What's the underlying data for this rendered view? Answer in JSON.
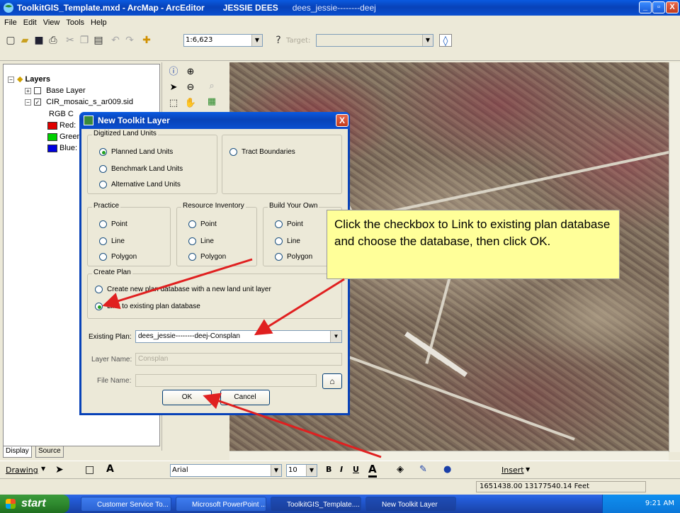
{
  "window": {
    "title": "ToolkitGIS_Template.mxd - ArcMap - ArcEditor",
    "user": "JESSIE DEES",
    "database_tag": "dees_jessie--------deej",
    "controls": {
      "minimize": "_",
      "maximize": "▫",
      "close": "X"
    }
  },
  "menu": [
    "File",
    "Edit",
    "View",
    "Tools",
    "Help"
  ],
  "toolbar": {
    "scale": "1:6,623",
    "target_label": "Target:",
    "target_value": ""
  },
  "toc": {
    "root": "Layers",
    "items": [
      {
        "label": "Base Layer",
        "checked": false
      },
      {
        "label": "CIR_mosaic_s_ar009.sid",
        "checked": true
      }
    ],
    "rgb_label": "RGB C",
    "bands": [
      {
        "label": "Red:",
        "color": "#e00000"
      },
      {
        "label": "Green:",
        "color": "#00d000"
      },
      {
        "label": "Blue:",
        "color": "#0000e0"
      }
    ],
    "tabs": [
      "Display",
      "Source"
    ]
  },
  "dialog": {
    "title": "New Toolkit Layer",
    "close_label": "X",
    "digitized": {
      "label": "Digitized Land Units",
      "options": [
        "Planned Land Units",
        "Benchmark Land Units",
        "Alternative Land Units"
      ],
      "tract": "Tract Boundaries"
    },
    "practice": {
      "label": "Practice",
      "options": [
        "Point",
        "Line",
        "Polygon"
      ]
    },
    "resource": {
      "label": "Resource Inventory",
      "options": [
        "Point",
        "Line",
        "Polygon"
      ]
    },
    "build": {
      "label": "Build Your Own",
      "options": [
        "Point",
        "Line",
        "Polygon"
      ]
    },
    "create_plan": {
      "label": "Create Plan",
      "new_db": "Create new plan database with a new land unit layer",
      "link_db": "Link to existing plan database"
    },
    "existing_plan": {
      "label": "Existing Plan:",
      "value": "dees_jessie--------deej-Consplan"
    },
    "layer_name": {
      "label": "Layer Name:",
      "value": "Consplan"
    },
    "file_name": {
      "label": "File Name:",
      "value": ""
    },
    "ok": "OK",
    "cancel": "Cancel"
  },
  "callout": "Click the checkbox to Link to existing plan database and choose the database, then click OK.",
  "drawbar": {
    "drawing": "Drawing",
    "font": "Arial",
    "size": "10",
    "insert": "Insert"
  },
  "status": {
    "coords": "1651438.00 13177540.14 Feet"
  },
  "taskbar": {
    "start": "start",
    "tasks": [
      "Customer Service To...",
      "Microsoft PowerPoint ...",
      "ToolkitGIS_Template....",
      "New Toolkit Layer"
    ],
    "time": "9:21 AM"
  },
  "colors": {
    "xp_blue": "#0842b8",
    "callout": "#ffff99",
    "arrow": "#e02020"
  }
}
